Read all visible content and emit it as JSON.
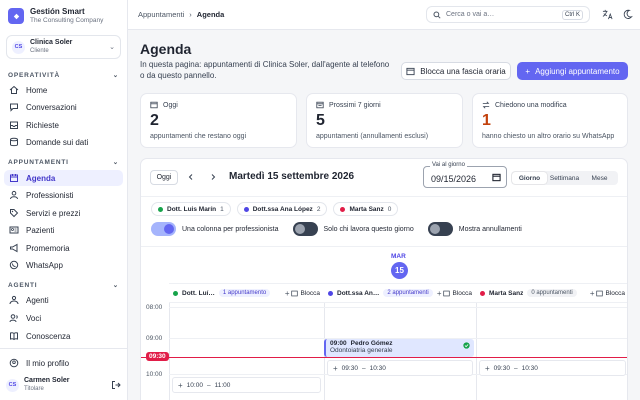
{
  "brand": {
    "name": "Gestión Smart",
    "subtitle": "The Consulting Company"
  },
  "tenant": {
    "initials": "CS",
    "name": "Clinica Soler",
    "role": "Cliente"
  },
  "sidebar": {
    "section_operativita": "OPERATIVITÀ",
    "section_appuntamenti": "APPUNTAMENTI",
    "section_agenti": "AGENTI",
    "items": [
      {
        "label": "Home",
        "icon": "home-icon"
      },
      {
        "label": "Conversazioni",
        "icon": "chat-icon"
      },
      {
        "label": "Richieste",
        "icon": "inbox-icon"
      },
      {
        "label": "Domande sui dati",
        "icon": "database-icon"
      },
      {
        "label": "Agenda",
        "icon": "calendar-icon"
      },
      {
        "label": "Professionisti",
        "icon": "user-icon"
      },
      {
        "label": "Servizi e prezzi",
        "icon": "tag-icon"
      },
      {
        "label": "Pazienti",
        "icon": "id-card-icon"
      },
      {
        "label": "Promemoria",
        "icon": "megaphone-icon"
      },
      {
        "label": "WhatsApp",
        "icon": "whatsapp-icon"
      },
      {
        "label": "Agenti",
        "icon": "bot-icon"
      },
      {
        "label": "Voci",
        "icon": "voice-icon"
      },
      {
        "label": "Conoscenza",
        "icon": "book-icon"
      }
    ],
    "profile_label": "Il mio profilo",
    "user": {
      "initials": "CS",
      "name": "Carmen Soler",
      "role": "Titolare"
    }
  },
  "topbar": {
    "crumb_root": "Appuntamenti",
    "crumb_current": "Agenda",
    "search_placeholder": "Cerca o vai a…",
    "shortcut": "Ctrl K"
  },
  "page": {
    "title": "Agenda",
    "description": "In questa pagina: appuntamenti di Clinica Soler, dall'agente al telefono o da questo pannello.",
    "block_button": "Blocca una fascia oraria",
    "add_button": "Aggiungi appuntamento"
  },
  "stats": [
    {
      "label": "Oggi",
      "value": "2",
      "desc": "appuntamenti che restano oggi",
      "color": "#1f2430"
    },
    {
      "label": "Prossimi 7 giorni",
      "value": "5",
      "desc": "appuntamenti (annullamenti esclusi)",
      "color": "#1f2430"
    },
    {
      "label": "Chiedono una modifica",
      "value": "1",
      "desc": "hanno chiesto un altro orario su WhatsApp",
      "color": "#c2410c"
    }
  ],
  "calendar": {
    "today_button": "Oggi",
    "current_date": "Martedì 15 settembre 2026",
    "goto_label": "Vai al giorno",
    "goto_value": "09/15/2026",
    "views": [
      "Giorno",
      "Settimana",
      "Mese"
    ],
    "active_view": "Giorno",
    "professionals": [
      {
        "name": "Dott. Luis Marín",
        "count": "1",
        "color": "#16a34a"
      },
      {
        "name": "Dott.ssa Ana López",
        "count": "2",
        "color": "#4f46e5"
      },
      {
        "name": "Marta Sanz",
        "count": "0",
        "color": "#e11d48"
      }
    ],
    "toggles": [
      {
        "label": "Una colonna per professionista",
        "on": true
      },
      {
        "label": "Solo chi lavora questo giorno",
        "on": false
      },
      {
        "label": "Mostra annullamenti",
        "on": false
      }
    ],
    "day_of_week": "MAR",
    "day_number": "15",
    "columns": [
      {
        "name": "Dott. Luí…",
        "badge": "1 appuntamento",
        "block": "Blocca",
        "color": "#16a34a"
      },
      {
        "name": "Dott.ssa An…",
        "badge": "2 appuntamenti",
        "block": "Blocca",
        "color": "#4f46e5"
      },
      {
        "name": "Marta Sanz",
        "badge": "0 appuntamenti",
        "block": "Blocca",
        "color": "#e11d48"
      }
    ],
    "hours": [
      "08:00",
      "09:00",
      "10:00"
    ],
    "now_label": "09:30",
    "appointment": {
      "time": "09:00",
      "patient": "Pedro Gómez",
      "service": "Odontoiatria generale"
    },
    "slots": [
      {
        "from": "09:30",
        "to": "10:30"
      },
      {
        "from": "09:30",
        "to": "10:30"
      },
      {
        "from": "10:00",
        "to": "11:00"
      }
    ]
  }
}
